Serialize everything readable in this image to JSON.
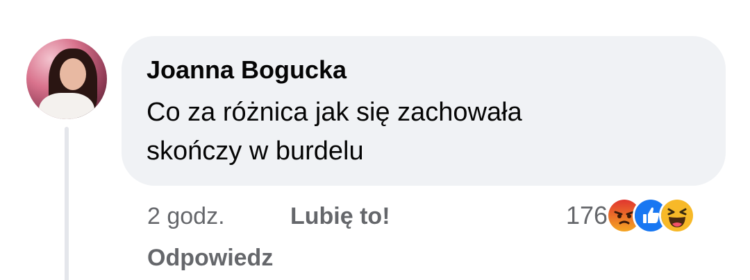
{
  "comment": {
    "author": "Joanna Bogucka",
    "text": "Co za różnica jak się zachowała\nskończy w burdelu",
    "time": "2 godz.",
    "like_label": "Lubię to!",
    "reply_label": "Odpowiedz",
    "reaction_count": "176",
    "reactions": [
      "angry-icon",
      "like-icon",
      "haha-icon"
    ]
  },
  "colors": {
    "bubble": "#f0f2f5",
    "meta_text": "#65676b",
    "primary_text": "#050505",
    "like_blue": "#1877f2",
    "angry_orange": "#e9710f",
    "haha_yellow": "#f7b928"
  }
}
